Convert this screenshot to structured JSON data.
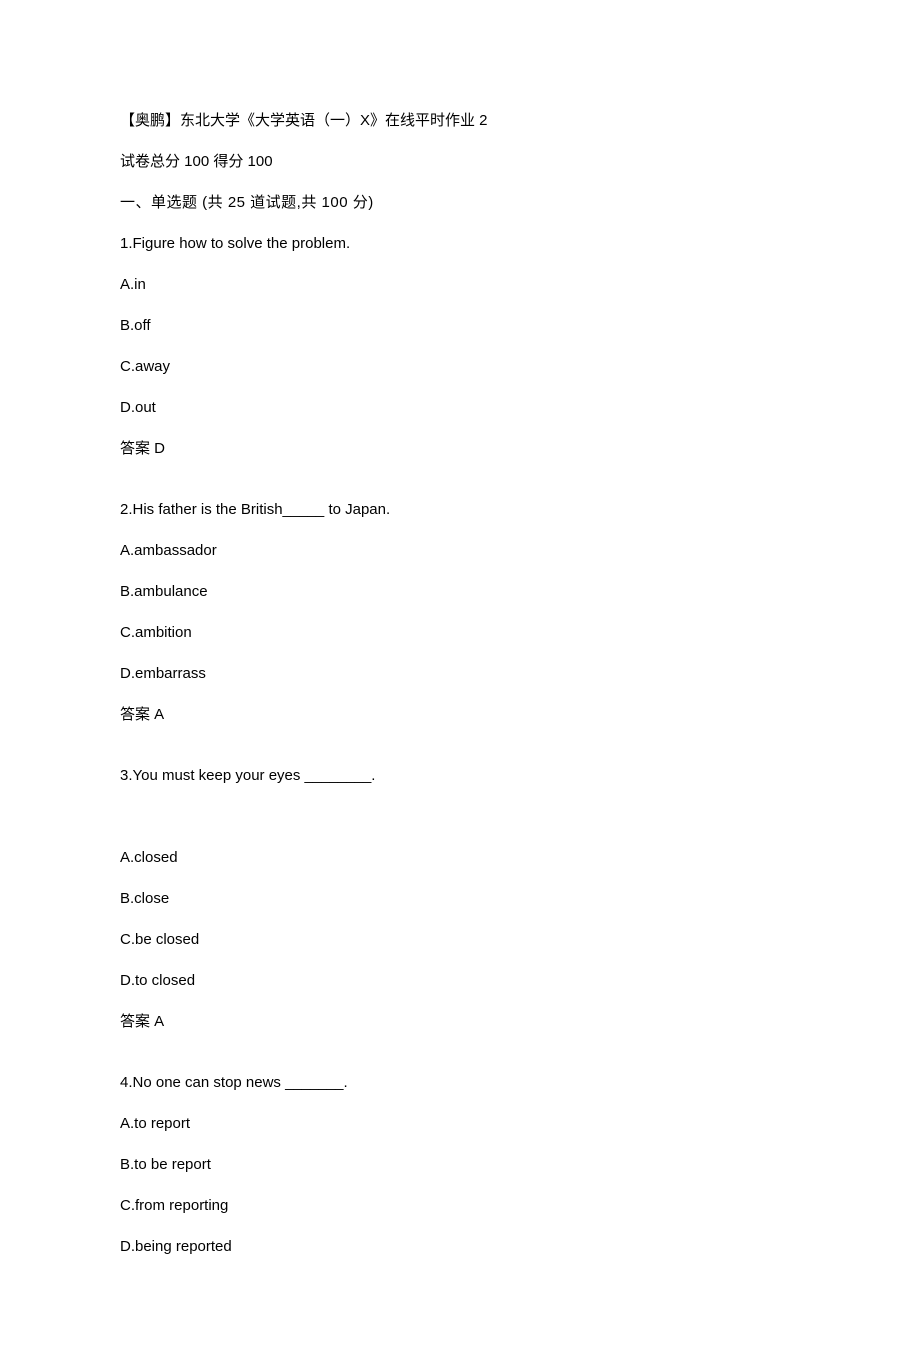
{
  "header": {
    "title": "【奥鹏】东北大学《大学英语（一）X》在线平时作业 2",
    "score_line": "试卷总分 100   得分 100",
    "section": "一、单选题 (共 25 道试题,共 100 分)"
  },
  "questions": [
    {
      "stem": "1.Figure            how to solve the problem.",
      "options": [
        "A.in",
        "B.off",
        "C.away",
        "D.out"
      ],
      "answer": "答案 D"
    },
    {
      "stem": "2.His father is the British_____ to Japan.",
      "options": [
        "A.ambassador",
        "B.ambulance",
        "C.ambition",
        "D.embarrass"
      ],
      "answer": "答案 A"
    },
    {
      "stem": "3.You must keep your eyes ________.",
      "extra_gap": true,
      "options": [
        "A.closed",
        "B.close",
        "C.be closed",
        "D.to closed"
      ],
      "answer": "答案 A"
    },
    {
      "stem": "4.No one can stop news _______.",
      "options": [
        "A.to report",
        "B.to be report",
        "C.from reporting",
        "D.being reported"
      ],
      "answer": null
    }
  ]
}
